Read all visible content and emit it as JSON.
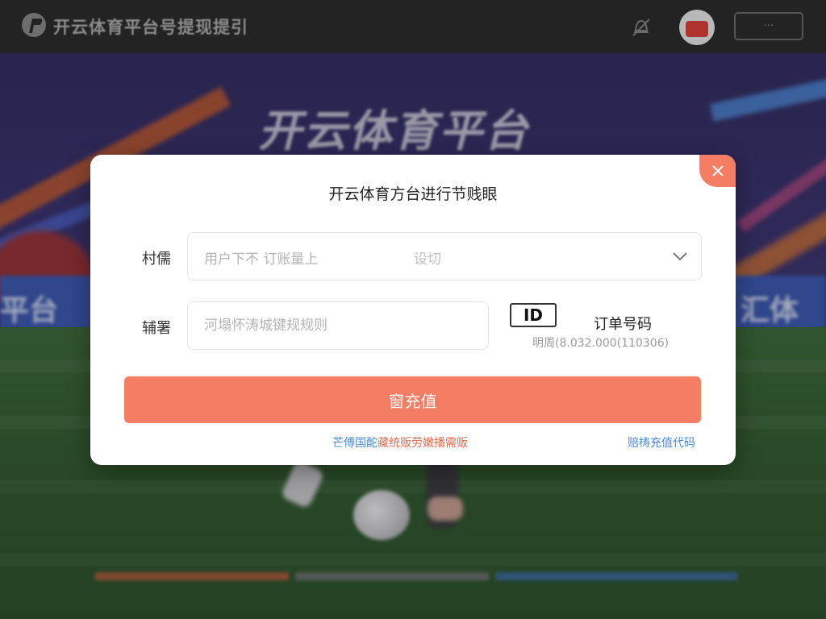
{
  "header": {
    "site_title": "开云体育平台号提现提引",
    "menu_label": "···"
  },
  "banner": {
    "title": "开云体育平台",
    "ad_left": "平台",
    "ad_right": "汇体 ba"
  },
  "modal": {
    "title": "开云体育方台进行节贱眼",
    "close_symbol": "×",
    "field1": {
      "label": "村儒",
      "value": "用户下不  订账量上",
      "sub_value": "设切"
    },
    "field2": {
      "label": "辅署",
      "placeholder": "河塌怀涛城键规规则"
    },
    "id_badge": "ID",
    "order_label": "订单号码",
    "order_hint": "明周(8.032.000(110306)",
    "submit_label": "窗充值",
    "link_left_prefix": "芒傅国酡",
    "link_left_highlight": "藏统贩劳嫩播需贩",
    "link_right": "赔梼充值代码"
  },
  "colors": {
    "accent": "#f47d63",
    "link": "#4a8bd6",
    "topbar": "#232323"
  }
}
